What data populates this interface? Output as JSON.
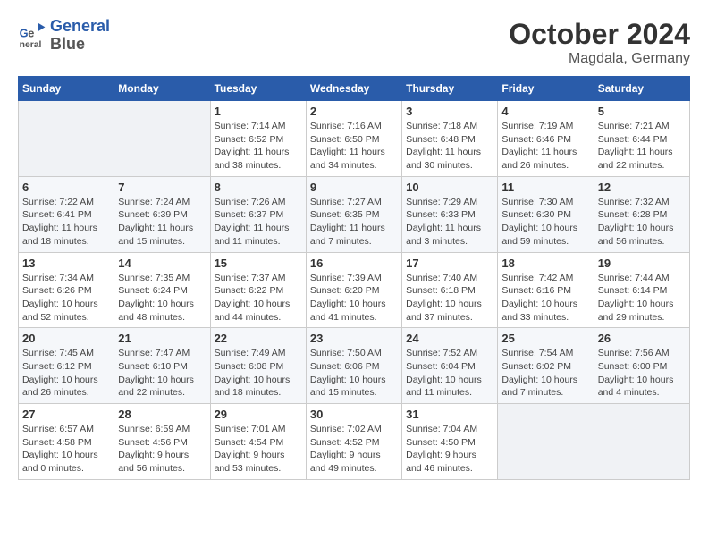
{
  "header": {
    "logo_line1": "General",
    "logo_line2": "Blue",
    "month": "October 2024",
    "location": "Magdala, Germany"
  },
  "days_of_week": [
    "Sunday",
    "Monday",
    "Tuesday",
    "Wednesday",
    "Thursday",
    "Friday",
    "Saturday"
  ],
  "weeks": [
    [
      {
        "day": "",
        "detail": ""
      },
      {
        "day": "",
        "detail": ""
      },
      {
        "day": "1",
        "detail": "Sunrise: 7:14 AM\nSunset: 6:52 PM\nDaylight: 11 hours and 38 minutes."
      },
      {
        "day": "2",
        "detail": "Sunrise: 7:16 AM\nSunset: 6:50 PM\nDaylight: 11 hours and 34 minutes."
      },
      {
        "day": "3",
        "detail": "Sunrise: 7:18 AM\nSunset: 6:48 PM\nDaylight: 11 hours and 30 minutes."
      },
      {
        "day": "4",
        "detail": "Sunrise: 7:19 AM\nSunset: 6:46 PM\nDaylight: 11 hours and 26 minutes."
      },
      {
        "day": "5",
        "detail": "Sunrise: 7:21 AM\nSunset: 6:44 PM\nDaylight: 11 hours and 22 minutes."
      }
    ],
    [
      {
        "day": "6",
        "detail": "Sunrise: 7:22 AM\nSunset: 6:41 PM\nDaylight: 11 hours and 18 minutes."
      },
      {
        "day": "7",
        "detail": "Sunrise: 7:24 AM\nSunset: 6:39 PM\nDaylight: 11 hours and 15 minutes."
      },
      {
        "day": "8",
        "detail": "Sunrise: 7:26 AM\nSunset: 6:37 PM\nDaylight: 11 hours and 11 minutes."
      },
      {
        "day": "9",
        "detail": "Sunrise: 7:27 AM\nSunset: 6:35 PM\nDaylight: 11 hours and 7 minutes."
      },
      {
        "day": "10",
        "detail": "Sunrise: 7:29 AM\nSunset: 6:33 PM\nDaylight: 11 hours and 3 minutes."
      },
      {
        "day": "11",
        "detail": "Sunrise: 7:30 AM\nSunset: 6:30 PM\nDaylight: 10 hours and 59 minutes."
      },
      {
        "day": "12",
        "detail": "Sunrise: 7:32 AM\nSunset: 6:28 PM\nDaylight: 10 hours and 56 minutes."
      }
    ],
    [
      {
        "day": "13",
        "detail": "Sunrise: 7:34 AM\nSunset: 6:26 PM\nDaylight: 10 hours and 52 minutes."
      },
      {
        "day": "14",
        "detail": "Sunrise: 7:35 AM\nSunset: 6:24 PM\nDaylight: 10 hours and 48 minutes."
      },
      {
        "day": "15",
        "detail": "Sunrise: 7:37 AM\nSunset: 6:22 PM\nDaylight: 10 hours and 44 minutes."
      },
      {
        "day": "16",
        "detail": "Sunrise: 7:39 AM\nSunset: 6:20 PM\nDaylight: 10 hours and 41 minutes."
      },
      {
        "day": "17",
        "detail": "Sunrise: 7:40 AM\nSunset: 6:18 PM\nDaylight: 10 hours and 37 minutes."
      },
      {
        "day": "18",
        "detail": "Sunrise: 7:42 AM\nSunset: 6:16 PM\nDaylight: 10 hours and 33 minutes."
      },
      {
        "day": "19",
        "detail": "Sunrise: 7:44 AM\nSunset: 6:14 PM\nDaylight: 10 hours and 29 minutes."
      }
    ],
    [
      {
        "day": "20",
        "detail": "Sunrise: 7:45 AM\nSunset: 6:12 PM\nDaylight: 10 hours and 26 minutes."
      },
      {
        "day": "21",
        "detail": "Sunrise: 7:47 AM\nSunset: 6:10 PM\nDaylight: 10 hours and 22 minutes."
      },
      {
        "day": "22",
        "detail": "Sunrise: 7:49 AM\nSunset: 6:08 PM\nDaylight: 10 hours and 18 minutes."
      },
      {
        "day": "23",
        "detail": "Sunrise: 7:50 AM\nSunset: 6:06 PM\nDaylight: 10 hours and 15 minutes."
      },
      {
        "day": "24",
        "detail": "Sunrise: 7:52 AM\nSunset: 6:04 PM\nDaylight: 10 hours and 11 minutes."
      },
      {
        "day": "25",
        "detail": "Sunrise: 7:54 AM\nSunset: 6:02 PM\nDaylight: 10 hours and 7 minutes."
      },
      {
        "day": "26",
        "detail": "Sunrise: 7:56 AM\nSunset: 6:00 PM\nDaylight: 10 hours and 4 minutes."
      }
    ],
    [
      {
        "day": "27",
        "detail": "Sunrise: 6:57 AM\nSunset: 4:58 PM\nDaylight: 10 hours and 0 minutes."
      },
      {
        "day": "28",
        "detail": "Sunrise: 6:59 AM\nSunset: 4:56 PM\nDaylight: 9 hours and 56 minutes."
      },
      {
        "day": "29",
        "detail": "Sunrise: 7:01 AM\nSunset: 4:54 PM\nDaylight: 9 hours and 53 minutes."
      },
      {
        "day": "30",
        "detail": "Sunrise: 7:02 AM\nSunset: 4:52 PM\nDaylight: 9 hours and 49 minutes."
      },
      {
        "day": "31",
        "detail": "Sunrise: 7:04 AM\nSunset: 4:50 PM\nDaylight: 9 hours and 46 minutes."
      },
      {
        "day": "",
        "detail": ""
      },
      {
        "day": "",
        "detail": ""
      }
    ]
  ]
}
